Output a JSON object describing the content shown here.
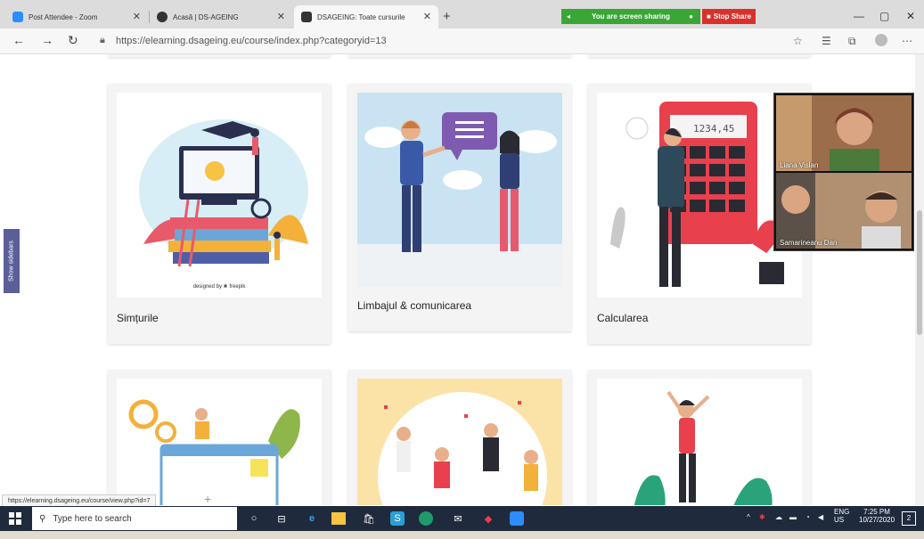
{
  "browser": {
    "tabs": [
      {
        "label": "Post Attendee - Zoom",
        "icon": "zoom-tab-icon",
        "color": "#2d8cff"
      },
      {
        "label": "Acasă | DS-AGEING",
        "icon": "moodle-tab-icon",
        "color": "#333333"
      },
      {
        "label": "DSAGEING: Toate cursurile",
        "icon": "moodle-tab-icon",
        "color": "#333333"
      }
    ],
    "url": "https://elearning.dsageing.eu/course/index.php?categoryid=13"
  },
  "zoom": {
    "sharing_text": "You are screen sharing",
    "stop_label": "Stop Share",
    "participants": [
      {
        "name": "Liana Vislan"
      },
      {
        "name": "Samarineanu Dan"
      }
    ]
  },
  "sidebar": {
    "label": "Show sidebars"
  },
  "courses": [
    {
      "title": "Simțurile",
      "credit": "designed by ❀ freepik"
    },
    {
      "title": "Limbajul & comunicarea"
    },
    {
      "title": "Calcularea",
      "display": "1234,45"
    }
  ],
  "status_url": "https://elearning.dsageing.eu/course/view.php?id=7",
  "taskbar": {
    "search_placeholder": "Type here to search",
    "lang": "ENG",
    "region": "US",
    "time": "7:25 PM",
    "date": "10/27/2020",
    "notifications": "2"
  },
  "colors": {
    "accent": "#5a5f9a",
    "zoom_green": "#3aa636",
    "stop_red": "#d9302c",
    "taskbar": "#1f2a3c"
  }
}
